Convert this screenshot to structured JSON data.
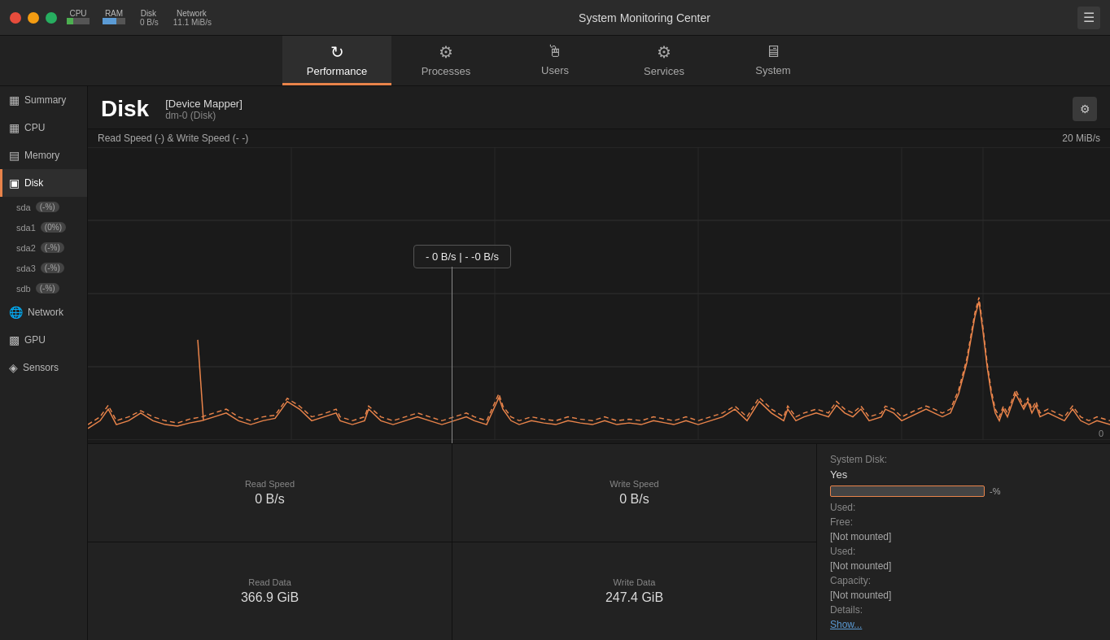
{
  "app": {
    "title": "System Monitoring Center"
  },
  "titlebar": {
    "cpu_label": "CPU",
    "ram_label": "RAM",
    "disk_label": "Disk",
    "network_label": "Network",
    "network_value": "11.1 MiB/s",
    "disk_value": "0 B/s",
    "menu_icon": "☰"
  },
  "tabs": [
    {
      "id": "performance",
      "label": "Performance",
      "icon": "⚡",
      "active": true
    },
    {
      "id": "processes",
      "label": "Processes",
      "icon": "⚙",
      "active": false
    },
    {
      "id": "users",
      "label": "Users",
      "icon": "🖱",
      "active": false
    },
    {
      "id": "services",
      "label": "Services",
      "icon": "⚙",
      "active": false
    },
    {
      "id": "system",
      "label": "System",
      "icon": "🖥",
      "active": false
    }
  ],
  "sidebar": {
    "items": [
      {
        "id": "summary",
        "label": "Summary",
        "icon": "📊",
        "active": false
      },
      {
        "id": "cpu",
        "label": "CPU",
        "icon": "🔲",
        "active": false
      },
      {
        "id": "memory",
        "label": "Memory",
        "icon": "🧮",
        "active": false
      },
      {
        "id": "disk",
        "label": "Disk",
        "icon": "💾",
        "active": true
      },
      {
        "id": "network",
        "label": "Network",
        "icon": "🌐",
        "active": false
      },
      {
        "id": "gpu",
        "label": "GPU",
        "icon": "🎮",
        "active": false
      },
      {
        "id": "sensors",
        "label": "Sensors",
        "icon": "🌡",
        "active": false
      }
    ],
    "sub_items": [
      {
        "id": "sda",
        "label": "sda",
        "badge": "(-%)"
      },
      {
        "id": "sda1",
        "label": "sda1",
        "badge": "(0%)"
      },
      {
        "id": "sda2",
        "label": "sda2",
        "badge": "(-%)"
      },
      {
        "id": "sda3",
        "label": "sda3",
        "badge": "(-%)"
      },
      {
        "id": "sdb",
        "label": "sdb",
        "badge": "(-%)"
      }
    ]
  },
  "disk_header": {
    "title": "Disk",
    "device_name": "[Device Mapper]",
    "device_id": "dm-0 (Disk)"
  },
  "chart": {
    "read_label": "Read Speed (-) & Write Speed (-  -)",
    "max_value": "20 MiB/s",
    "min_value": "0",
    "tooltip_text": "- 0 B/s  |  - -0 B/s"
  },
  "stats": {
    "read_speed_label": "Read Speed",
    "read_speed_value": "0 B/s",
    "write_speed_label": "Write Speed",
    "write_speed_value": "0 B/s",
    "read_data_label": "Read Data",
    "read_data_value": "366.9 GiB",
    "write_data_label": "Write Data",
    "write_data_value": "247.4 GiB"
  },
  "disk_info": {
    "system_disk_label": "System Disk:",
    "system_disk_value": "Yes",
    "used_label": "Used:",
    "used_value": "",
    "free_label": "Free:",
    "free_value": "",
    "used2_label": "Used:",
    "used2_value": "",
    "capacity_label": "Capacity:",
    "capacity_value": "",
    "details_label": "Details:",
    "details_value": "",
    "percent_value": "-%",
    "not_mounted_1": "[Not mounted]",
    "not_mounted_2": "[Not mounted]",
    "not_mounted_3": "[Not mounted]",
    "show_link": "Show..."
  }
}
